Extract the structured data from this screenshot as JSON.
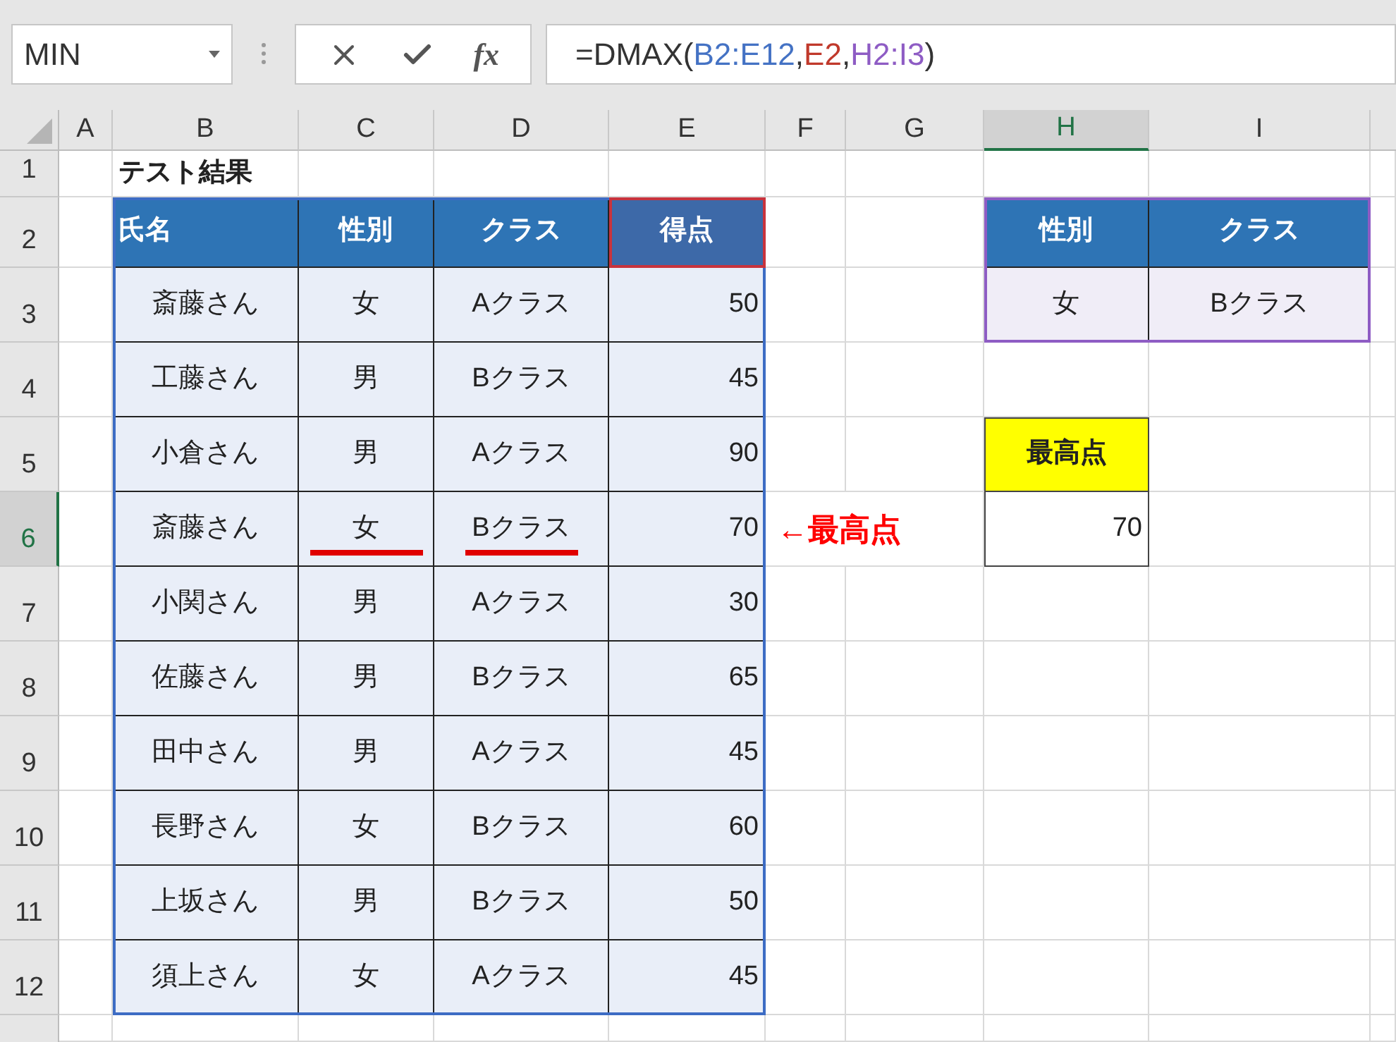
{
  "name_box": {
    "value": "MIN"
  },
  "formula_bar": {
    "function_label": "fx",
    "formula": [
      {
        "text": "=DMAX("
      },
      {
        "text": "B2:E12",
        "color": "#4472c4"
      },
      {
        "text": ","
      },
      {
        "text": "E2",
        "color": "#c0392b"
      },
      {
        "text": ","
      },
      {
        "text": "H2:I3",
        "color": "#8e5cc4"
      },
      {
        "text": ")"
      }
    ]
  },
  "columns": [
    {
      "label": "A",
      "selected": false
    },
    {
      "label": "B",
      "selected": false
    },
    {
      "label": "C",
      "selected": false
    },
    {
      "label": "D",
      "selected": false
    },
    {
      "label": "E",
      "selected": false
    },
    {
      "label": "F",
      "selected": false
    },
    {
      "label": "G",
      "selected": false
    },
    {
      "label": "H",
      "selected": true
    },
    {
      "label": "I",
      "selected": false
    }
  ],
  "rows": [
    {
      "label": "1",
      "selected": false
    },
    {
      "label": "2",
      "selected": false
    },
    {
      "label": "3",
      "selected": false
    },
    {
      "label": "4",
      "selected": false
    },
    {
      "label": "5",
      "selected": false
    },
    {
      "label": "6",
      "selected": true
    },
    {
      "label": "7",
      "selected": false
    },
    {
      "label": "8",
      "selected": false
    },
    {
      "label": "9",
      "selected": false
    },
    {
      "label": "10",
      "selected": false
    },
    {
      "label": "11",
      "selected": false
    },
    {
      "label": "12",
      "selected": false
    }
  ],
  "title": "テスト結果",
  "data_table": {
    "columns": [
      "氏名",
      "性別",
      "クラス",
      "得点"
    ],
    "rows": [
      {
        "name": "斎藤さん",
        "gender": "女",
        "class": "Aクラス",
        "score": "50",
        "underlined": false
      },
      {
        "name": "工藤さん",
        "gender": "男",
        "class": "Bクラス",
        "score": "45",
        "underlined": false
      },
      {
        "name": "小倉さん",
        "gender": "男",
        "class": "Aクラス",
        "score": "90",
        "underlined": false
      },
      {
        "name": "斎藤さん",
        "gender": "女",
        "class": "Bクラス",
        "score": "70",
        "underlined": true
      },
      {
        "name": "小関さん",
        "gender": "男",
        "class": "Aクラス",
        "score": "30",
        "underlined": false
      },
      {
        "name": "佐藤さん",
        "gender": "男",
        "class": "Bクラス",
        "score": "65",
        "underlined": false
      },
      {
        "name": "田中さん",
        "gender": "男",
        "class": "Aクラス",
        "score": "45",
        "underlined": false
      },
      {
        "name": "長野さん",
        "gender": "女",
        "class": "Bクラス",
        "score": "60",
        "underlined": false
      },
      {
        "name": "上坂さん",
        "gender": "男",
        "class": "Bクラス",
        "score": "50",
        "underlined": false
      },
      {
        "name": "須上さん",
        "gender": "女",
        "class": "Aクラス",
        "score": "45",
        "underlined": false
      }
    ]
  },
  "criteria": {
    "columns": [
      "性別",
      "クラス"
    ],
    "values": [
      "女",
      "Bクラス"
    ]
  },
  "result": {
    "label": "最高点",
    "value": "70"
  },
  "annotation": "←最高点"
}
